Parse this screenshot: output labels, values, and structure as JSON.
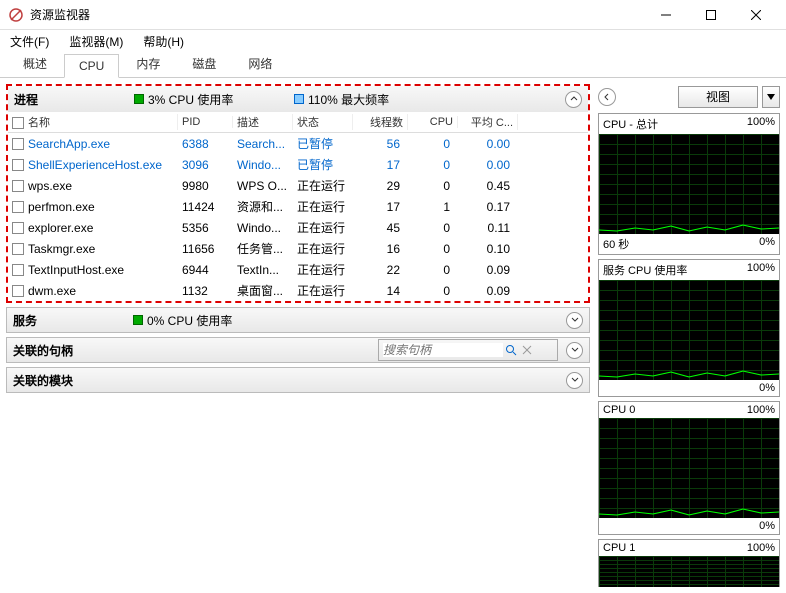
{
  "window": {
    "title": "资源监视器"
  },
  "menu": {
    "file": "文件(F)",
    "monitor": "监视器(M)",
    "help": "帮助(H)"
  },
  "tabs": {
    "overview": "概述",
    "cpu": "CPU",
    "memory": "内存",
    "disk": "磁盘",
    "network": "网络"
  },
  "processes": {
    "title": "进程",
    "usage_label": "3% CPU 使用率",
    "freq_label": "110% 最大频率",
    "columns": {
      "name": "名称",
      "pid": "PID",
      "desc": "描述",
      "status": "状态",
      "threads": "线程数",
      "cpu": "CPU",
      "avg": "平均 C..."
    },
    "rows": [
      {
        "name": "SearchApp.exe",
        "pid": "6388",
        "desc": "Search...",
        "status": "已暂停",
        "threads": "56",
        "cpu": "0",
        "avg": "0.00",
        "blue": true
      },
      {
        "name": "ShellExperienceHost.exe",
        "pid": "3096",
        "desc": "Windo...",
        "status": "已暂停",
        "threads": "17",
        "cpu": "0",
        "avg": "0.00",
        "blue": true
      },
      {
        "name": "wps.exe",
        "pid": "9980",
        "desc": "WPS O...",
        "status": "正在运行",
        "threads": "29",
        "cpu": "0",
        "avg": "0.45"
      },
      {
        "name": "perfmon.exe",
        "pid": "11424",
        "desc": "资源和...",
        "status": "正在运行",
        "threads": "17",
        "cpu": "1",
        "avg": "0.17"
      },
      {
        "name": "explorer.exe",
        "pid": "5356",
        "desc": "Windo...",
        "status": "正在运行",
        "threads": "45",
        "cpu": "0",
        "avg": "0.11"
      },
      {
        "name": "Taskmgr.exe",
        "pid": "11656",
        "desc": "任务管...",
        "status": "正在运行",
        "threads": "16",
        "cpu": "0",
        "avg": "0.10"
      },
      {
        "name": "TextInputHost.exe",
        "pid": "6944",
        "desc": "TextIn...",
        "status": "正在运行",
        "threads": "22",
        "cpu": "0",
        "avg": "0.09"
      },
      {
        "name": "dwm.exe",
        "pid": "1132",
        "desc": "桌面窗...",
        "status": "正在运行",
        "threads": "14",
        "cpu": "0",
        "avg": "0.09"
      }
    ]
  },
  "services": {
    "title": "服务",
    "usage_label": "0% CPU 使用率"
  },
  "handles": {
    "title": "关联的句柄",
    "search_placeholder": "搜索句柄"
  },
  "modules": {
    "title": "关联的模块"
  },
  "side": {
    "view_label": "视图",
    "graphs": [
      {
        "title": "CPU - 总计",
        "right": "100%",
        "foot_left": "60 秒",
        "foot_right": "0%"
      },
      {
        "title": "服务 CPU 使用率",
        "right": "100%",
        "foot_left": "",
        "foot_right": "0%"
      },
      {
        "title": "CPU 0",
        "right": "100%",
        "foot_left": "",
        "foot_right": "0%"
      },
      {
        "title": "CPU 1",
        "right": "100%",
        "foot_left": "",
        "foot_right": ""
      }
    ]
  }
}
